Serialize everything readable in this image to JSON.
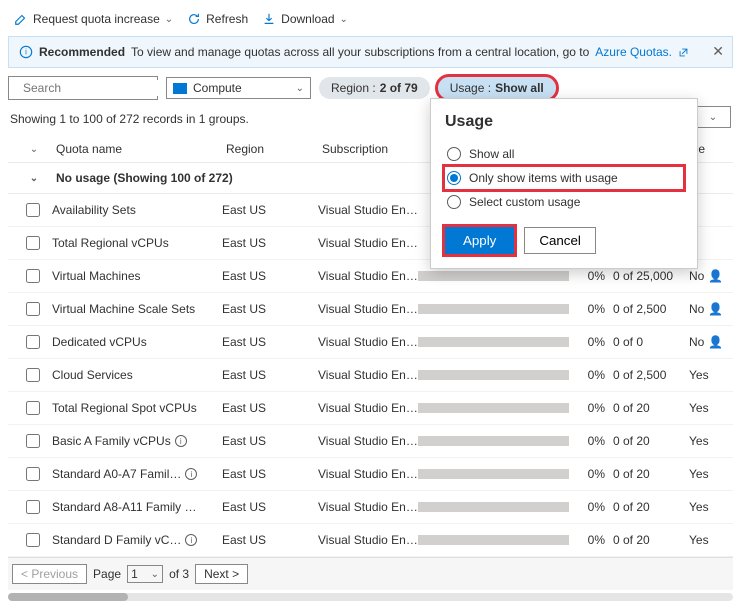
{
  "toolbar": {
    "request": "Request quota increase",
    "refresh": "Refresh",
    "download": "Download"
  },
  "banner": {
    "label": "Recommended",
    "text": "To view and manage quotas across all your subscriptions from a central location, go to ",
    "link": "Azure Quotas."
  },
  "filters": {
    "search_placeholder": "Search",
    "provider": "Compute",
    "region_label": "Region :",
    "region_value": "2 of 79",
    "usage_label": "Usage :",
    "usage_value": "Show all"
  },
  "records": "Showing 1 to 100 of 272 records in 1 groups.",
  "headers": {
    "name": "Quota name",
    "region": "Region",
    "subscription": "Subscription",
    "adjustable_suffix": "ble"
  },
  "group": "No usage (Showing 100 of 272)",
  "rows": [
    {
      "name": "Availability Sets",
      "region": "East US",
      "sub": "Visual Studio En…",
      "pct": "",
      "quota": "",
      "adj": ""
    },
    {
      "name": "Total Regional vCPUs",
      "region": "East US",
      "sub": "Visual Studio En…",
      "pct": "",
      "quota": "",
      "adj": ""
    },
    {
      "name": "Virtual Machines",
      "region": "East US",
      "sub": "Visual Studio En…",
      "pct": "0%",
      "quota": "0 of 25,000",
      "adj": "No",
      "person": true
    },
    {
      "name": "Virtual Machine Scale Sets",
      "region": "East US",
      "sub": "Visual Studio En…",
      "pct": "0%",
      "quota": "0 of 2,500",
      "adj": "No",
      "person": true
    },
    {
      "name": "Dedicated vCPUs",
      "region": "East US",
      "sub": "Visual Studio En…",
      "pct": "0%",
      "quota": "0 of 0",
      "adj": "No",
      "person": true
    },
    {
      "name": "Cloud Services",
      "region": "East US",
      "sub": "Visual Studio En…",
      "pct": "0%",
      "quota": "0 of 2,500",
      "adj": "Yes"
    },
    {
      "name": "Total Regional Spot vCPUs",
      "region": "East US",
      "sub": "Visual Studio En…",
      "pct": "0%",
      "quota": "0 of 20",
      "adj": "Yes"
    },
    {
      "name": "Basic A Family vCPUs",
      "info": true,
      "region": "East US",
      "sub": "Visual Studio En…",
      "pct": "0%",
      "quota": "0 of 20",
      "adj": "Yes"
    },
    {
      "name": "Standard A0-A7 Famil…",
      "info": true,
      "region": "East US",
      "sub": "Visual Studio En…",
      "pct": "0%",
      "quota": "0 of 20",
      "adj": "Yes"
    },
    {
      "name": "Standard A8-A11 Family …",
      "region": "East US",
      "sub": "Visual Studio En…",
      "pct": "0%",
      "quota": "0 of 20",
      "adj": "Yes"
    },
    {
      "name": "Standard D Family vC…",
      "info": true,
      "region": "East US",
      "sub": "Visual Studio En…",
      "pct": "0%",
      "quota": "0 of 20",
      "adj": "Yes"
    }
  ],
  "pager": {
    "prev": "< Previous",
    "page_label": "Page",
    "page": "1",
    "of": "of 3",
    "next": "Next >"
  },
  "popover": {
    "title": "Usage",
    "opt1": "Show all",
    "opt2": "Only show items with usage",
    "opt3": "Select custom usage",
    "apply": "Apply",
    "cancel": "Cancel"
  }
}
